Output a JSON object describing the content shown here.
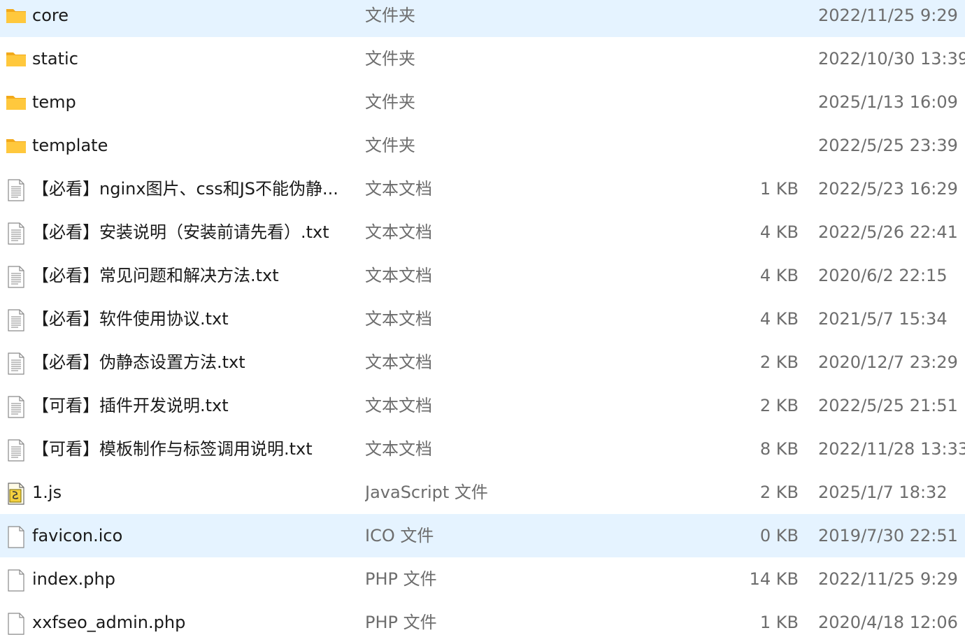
{
  "colors": {
    "folder_body": "#ffc83d",
    "folder_tab": "#f2a91a",
    "selected_row": "#e5f3ff",
    "name_text": "#1a1a1a",
    "meta_text": "#6d6d6d"
  },
  "files": [
    {
      "name": "core",
      "type": "文件夹",
      "size": "",
      "date": "2022/11/25 9:29",
      "icon": "folder-icon",
      "selected": false
    },
    {
      "name": "static",
      "type": "文件夹",
      "size": "",
      "date": "2022/10/30 13:39",
      "icon": "folder-icon",
      "selected": false
    },
    {
      "name": "temp",
      "type": "文件夹",
      "size": "",
      "date": "2025/1/13 16:09",
      "icon": "folder-icon",
      "selected": false
    },
    {
      "name": "template",
      "type": "文件夹",
      "size": "",
      "date": "2022/5/25 23:39",
      "icon": "folder-icon",
      "selected": false
    },
    {
      "name": "【必看】nginx图片、css和JS不能伪静...",
      "type": "文本文档",
      "size": "1 KB",
      "date": "2022/5/23 16:29",
      "icon": "text-file-icon",
      "selected": false
    },
    {
      "name": "【必看】安装说明（安装前请先看）.txt",
      "type": "文本文档",
      "size": "4 KB",
      "date": "2022/5/26 22:41",
      "icon": "text-file-icon",
      "selected": false
    },
    {
      "name": "【必看】常见问题和解决方法.txt",
      "type": "文本文档",
      "size": "4 KB",
      "date": "2020/6/2 22:15",
      "icon": "text-file-icon",
      "selected": false
    },
    {
      "name": "【必看】软件使用协议.txt",
      "type": "文本文档",
      "size": "4 KB",
      "date": "2021/5/7 15:34",
      "icon": "text-file-icon",
      "selected": false
    },
    {
      "name": "【必看】伪静态设置方法.txt",
      "type": "文本文档",
      "size": "2 KB",
      "date": "2020/12/7 23:29",
      "icon": "text-file-icon",
      "selected": false
    },
    {
      "name": "【可看】插件开发说明.txt",
      "type": "文本文档",
      "size": "2 KB",
      "date": "2022/5/25 21:51",
      "icon": "text-file-icon",
      "selected": false
    },
    {
      "name": "【可看】模板制作与标签调用说明.txt",
      "type": "文本文档",
      "size": "8 KB",
      "date": "2022/11/28 13:33",
      "icon": "text-file-icon",
      "selected": false
    },
    {
      "name": "1.js",
      "type": "JavaScript 文件",
      "size": "2 KB",
      "date": "2025/1/7 18:32",
      "icon": "script-file-icon",
      "selected": false
    },
    {
      "name": "favicon.ico",
      "type": "ICO 文件",
      "size": "0 KB",
      "date": "2019/7/30 22:51",
      "icon": "blank-file-icon",
      "selected": true
    },
    {
      "name": "index.php",
      "type": "PHP 文件",
      "size": "14 KB",
      "date": "2022/11/25 9:29",
      "icon": "blank-file-icon",
      "selected": false
    },
    {
      "name": "xxfseo_admin.php",
      "type": "PHP 文件",
      "size": "1 KB",
      "date": "2020/4/18 12:06",
      "icon": "blank-file-icon",
      "selected": false
    }
  ]
}
